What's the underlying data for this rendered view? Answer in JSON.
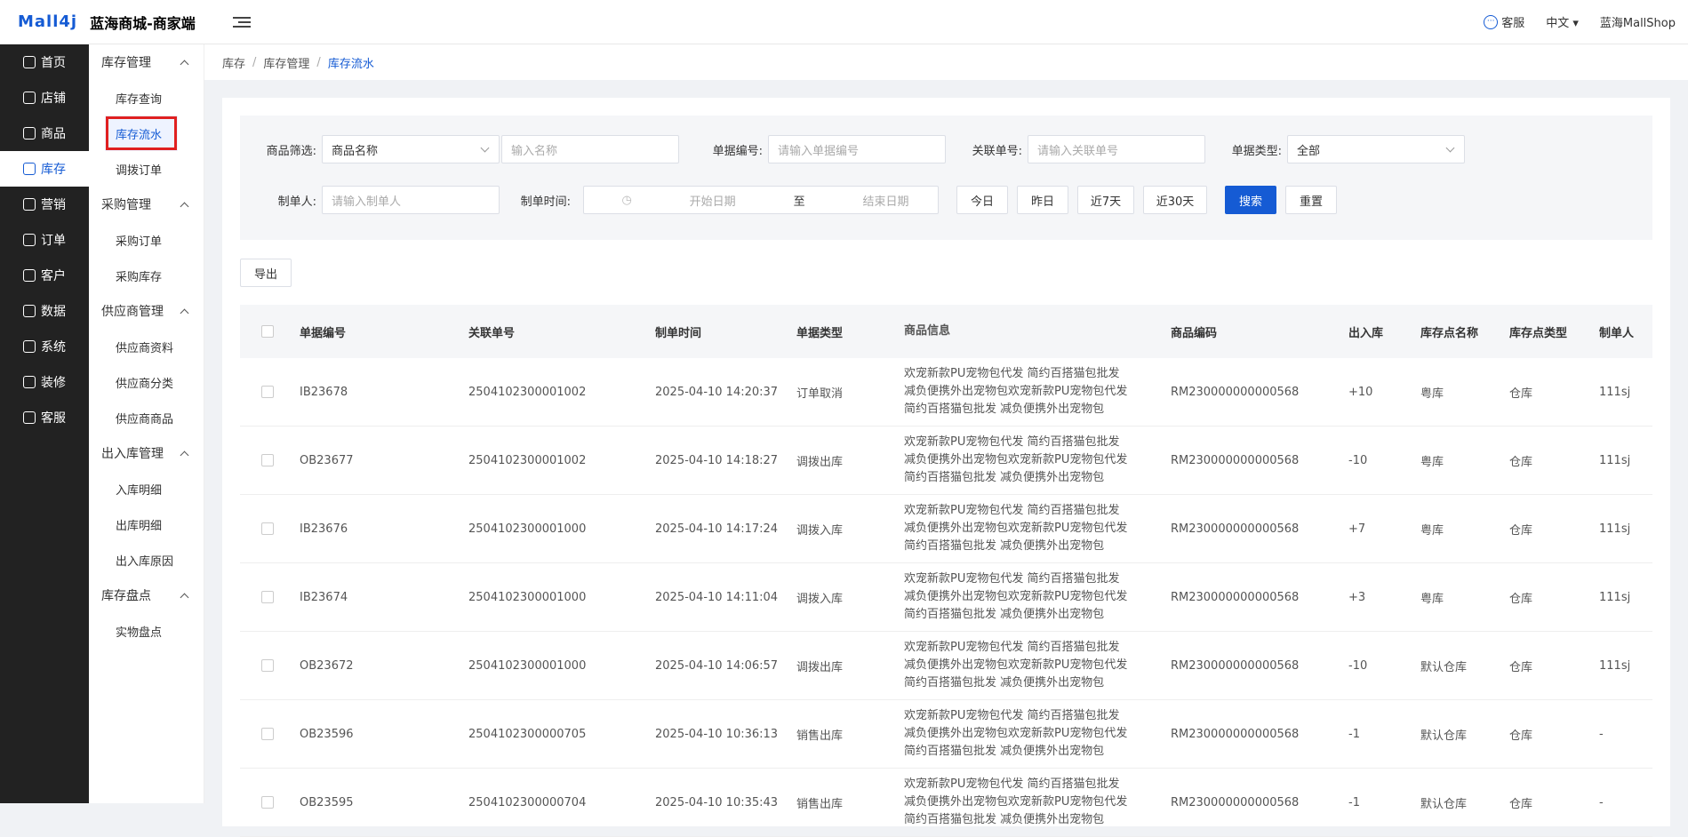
{
  "topbar": {
    "logo": "Mall4j",
    "brand": "蓝海商城-商家端",
    "service": "客服",
    "language": "中文",
    "user": "蓝海MallShop"
  },
  "sidebar1": [
    {
      "label": "首页",
      "icon": "home-icon"
    },
    {
      "label": "店铺",
      "icon": "store-icon"
    },
    {
      "label": "商品",
      "icon": "goods-icon"
    },
    {
      "label": "库存",
      "icon": "inventory-icon",
      "active": true
    },
    {
      "label": "营销",
      "icon": "marketing-icon"
    },
    {
      "label": "订单",
      "icon": "order-icon"
    },
    {
      "label": "客户",
      "icon": "customer-icon"
    },
    {
      "label": "数据",
      "icon": "data-icon"
    },
    {
      "label": "系统",
      "icon": "system-icon"
    },
    {
      "label": "装修",
      "icon": "decoration-icon"
    },
    {
      "label": "客服",
      "icon": "chat-icon"
    }
  ],
  "sidebar2": {
    "g1": "库存管理",
    "g1i1": "库存查询",
    "g1i2": "库存流水",
    "g1i3": "调拨订单",
    "g2": "采购管理",
    "g2i1": "采购订单",
    "g2i2": "采购库存",
    "g3": "供应商管理",
    "g3i1": "供应商资料",
    "g3i2": "供应商分类",
    "g3i3": "供应商商品",
    "g4": "出入库管理",
    "g4i1": "入库明细",
    "g4i2": "出库明细",
    "g4i3": "出入库原因",
    "g5": "库存盘点",
    "g5i1": "实物盘点"
  },
  "breadcrumb": {
    "b1": "库存",
    "b2": "库存管理",
    "b3": "库存流水",
    "sep": "/"
  },
  "filter": {
    "goods_label": "商品筛选:",
    "goods_select": "商品名称",
    "goods_placeholder": "输入名称",
    "doc_label": "单据编号:",
    "doc_placeholder": "请输入单据编号",
    "rel_label": "关联单号:",
    "rel_placeholder": "请输入关联单号",
    "type_label": "单据类型:",
    "type_value": "全部",
    "maker_label": "制单人:",
    "maker_placeholder": "请输入制单人",
    "time_label": "制单时间:",
    "start": "开始日期",
    "to": "至",
    "end": "结束日期",
    "today": "今日",
    "yesterday": "昨日",
    "d7": "近7天",
    "d30": "近30天",
    "search": "搜索",
    "reset": "重置"
  },
  "export_label": "导出",
  "table": {
    "headers": {
      "h1": "单据编号",
      "h2": "关联单号",
      "h3": "制单时间",
      "h4": "单据类型",
      "h5": "商品信息",
      "h6": "商品编码",
      "h7": "出入库",
      "h8": "库存点名称",
      "h9": "库存点类型",
      "h10": "制单人"
    },
    "rows": [
      {
        "doc": "IB23678",
        "rel": "2504102300001002",
        "time": "2025-04-10 14:20:37",
        "type": "订单取消",
        "info": "欢宠新款PU宠物包代发 简约百搭猫包批发\n减负便携外出宠物包欢宠新款PU宠物包代发\n简约百搭猫包批发 减负便携外出宠物包",
        "code": "RM230000000000568",
        "qty": "+10",
        "point": "粤库",
        "ptype": "仓库",
        "maker": "111sj"
      },
      {
        "doc": "OB23677",
        "rel": "2504102300001002",
        "time": "2025-04-10 14:18:27",
        "type": "调拨出库",
        "info": "欢宠新款PU宠物包代发 简约百搭猫包批发\n减负便携外出宠物包欢宠新款PU宠物包代发\n简约百搭猫包批发 减负便携外出宠物包",
        "code": "RM230000000000568",
        "qty": "-10",
        "point": "粤库",
        "ptype": "仓库",
        "maker": "111sj"
      },
      {
        "doc": "IB23676",
        "rel": "2504102300001000",
        "time": "2025-04-10 14:17:24",
        "type": "调拨入库",
        "info": "欢宠新款PU宠物包代发 简约百搭猫包批发\n减负便携外出宠物包欢宠新款PU宠物包代发\n简约百搭猫包批发 减负便携外出宠物包",
        "code": "RM230000000000568",
        "qty": "+7",
        "point": "粤库",
        "ptype": "仓库",
        "maker": "111sj"
      },
      {
        "doc": "IB23674",
        "rel": "2504102300001000",
        "time": "2025-04-10 14:11:04",
        "type": "调拨入库",
        "info": "欢宠新款PU宠物包代发 简约百搭猫包批发\n减负便携外出宠物包欢宠新款PU宠物包代发\n简约百搭猫包批发 减负便携外出宠物包",
        "code": "RM230000000000568",
        "qty": "+3",
        "point": "粤库",
        "ptype": "仓库",
        "maker": "111sj"
      },
      {
        "doc": "OB23672",
        "rel": "2504102300001000",
        "time": "2025-04-10 14:06:57",
        "type": "调拨出库",
        "info": "欢宠新款PU宠物包代发 简约百搭猫包批发\n减负便携外出宠物包欢宠新款PU宠物包代发\n简约百搭猫包批发 减负便携外出宠物包",
        "code": "RM230000000000568",
        "qty": "-10",
        "point": "默认仓库",
        "ptype": "仓库",
        "maker": "111sj"
      },
      {
        "doc": "OB23596",
        "rel": "2504102300000705",
        "time": "2025-04-10 10:36:13",
        "type": "销售出库",
        "info": "欢宠新款PU宠物包代发 简约百搭猫包批发\n减负便携外出宠物包欢宠新款PU宠物包代发\n简约百搭猫包批发 减负便携外出宠物包",
        "code": "RM230000000000568",
        "qty": "-1",
        "point": "默认仓库",
        "ptype": "仓库",
        "maker": "-"
      },
      {
        "doc": "OB23595",
        "rel": "2504102300000704",
        "time": "2025-04-10 10:35:43",
        "type": "销售出库",
        "info": "欢宠新款PU宠物包代发 简约百搭猫包批发\n减负便携外出宠物包欢宠新款PU宠物包代发\n简约百搭猫包批发 减负便携外出宠物包",
        "code": "RM230000000000568",
        "qty": "-1",
        "point": "默认仓库",
        "ptype": "仓库",
        "maker": "-"
      }
    ]
  },
  "colors": {
    "accent": "#155bd4",
    "sidebar": "#222222",
    "highlight": "#e02020"
  }
}
